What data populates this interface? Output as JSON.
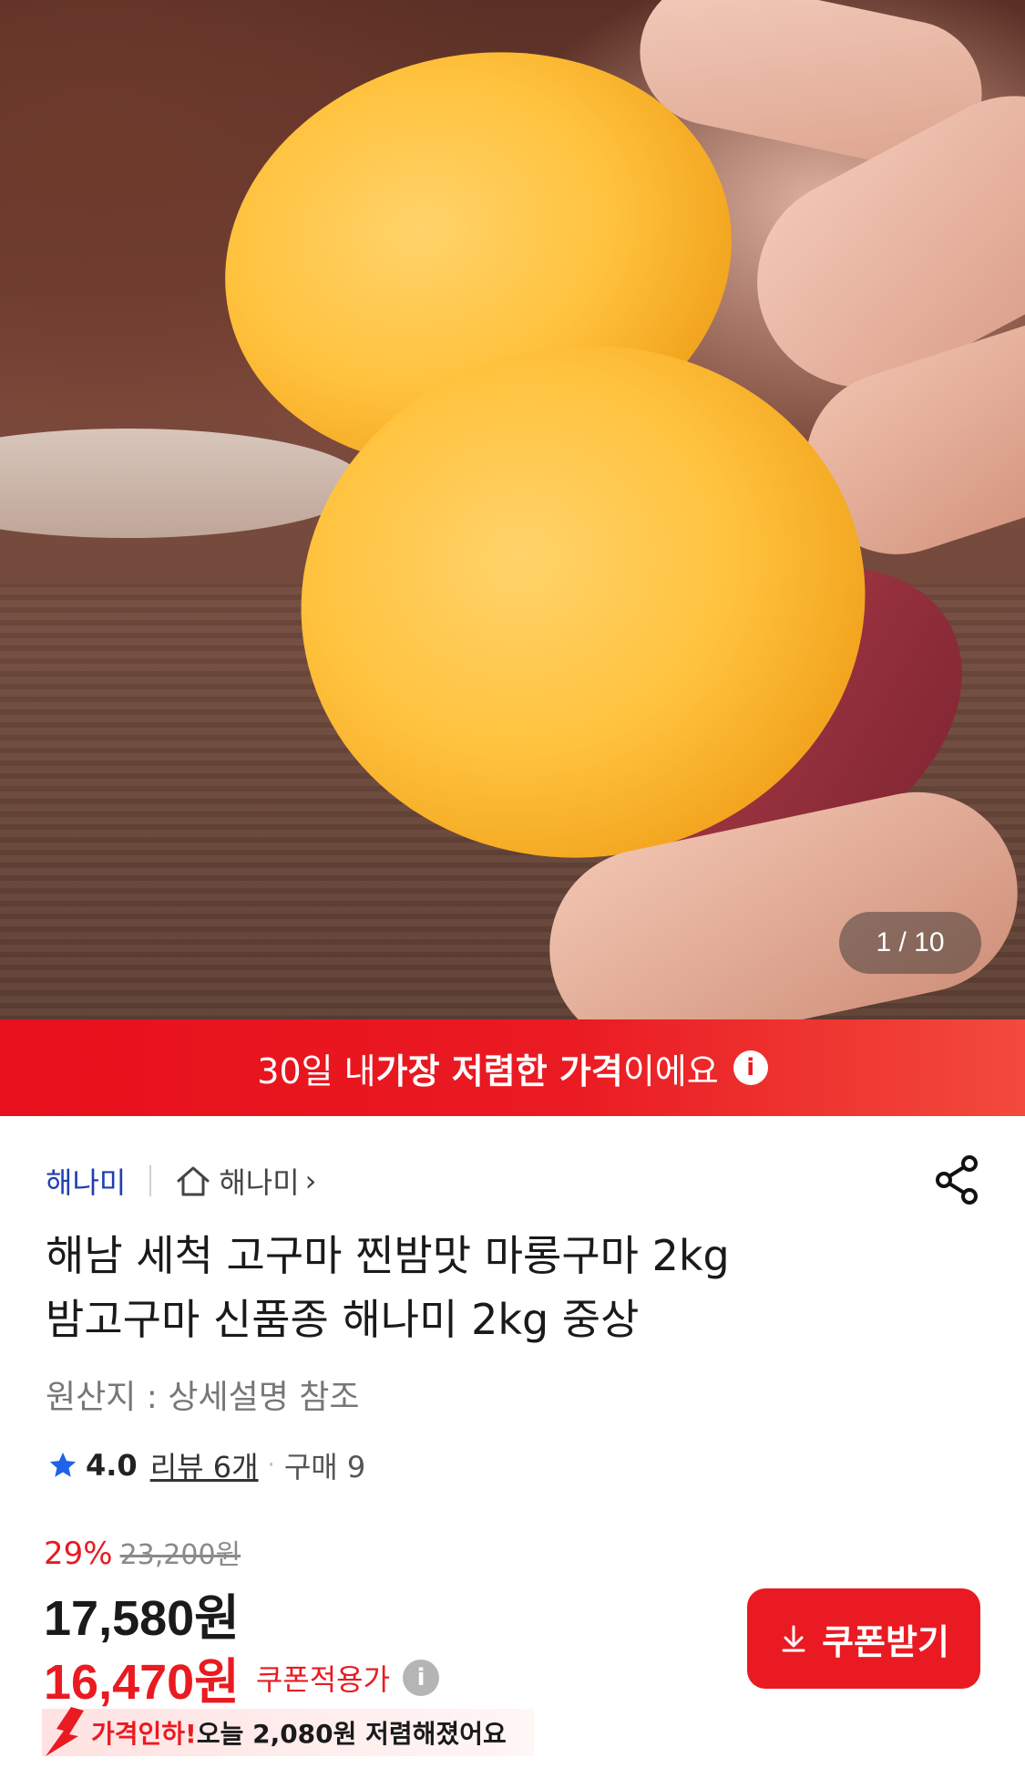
{
  "hero": {
    "image_counter": "1 / 10"
  },
  "banner": {
    "prefix": "30일 내 ",
    "highlight": "가장 저렴한 가격",
    "suffix": "이에요",
    "info_icon": "info-icon"
  },
  "seller": {
    "brand": "해나미",
    "store_link": "해나미",
    "chevron": "›"
  },
  "product": {
    "title_line1": "해남 세척 고구마 찐밤맛 마롱구마 2kg",
    "title_line2": "밤고구마 신품종 해나미 2kg 중상",
    "origin": "원산지 : 상세설명 참조"
  },
  "rating": {
    "score": "4.0",
    "reviews": "리뷰 6개",
    "separator": "·",
    "purchases": "구매 9"
  },
  "pricing": {
    "discount_percent": "29%",
    "original_price": "23,200원",
    "sale_price": "17,580원",
    "coupon_price": "16,470원",
    "coupon_label": "쿠폰적용가",
    "info_icon_glyph": "i"
  },
  "coupon_button": {
    "label": "쿠폰받기"
  },
  "price_drop": {
    "lead": "가격인하!",
    "message": " 오늘 2,080원 저렴해졌어요"
  },
  "colors": {
    "accent_red": "#ea1a22",
    "brand_blue": "#1f3fae"
  }
}
